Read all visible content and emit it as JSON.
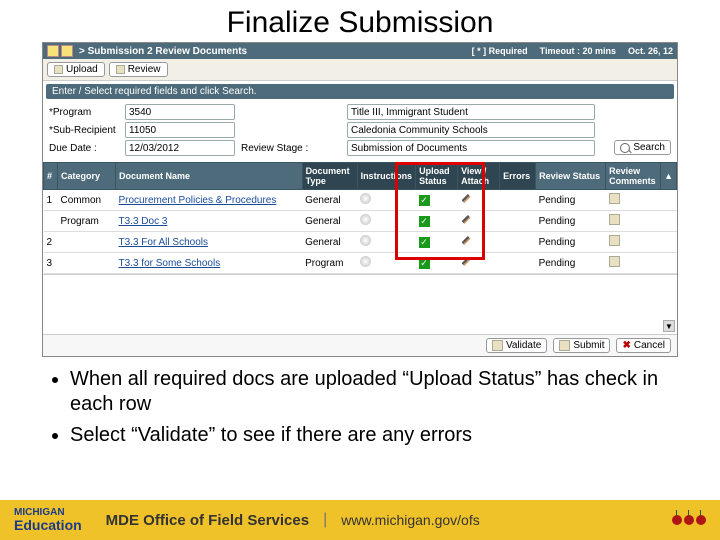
{
  "slide_title": "Finalize Submission",
  "crumb": {
    "path": "> Submission 2 Review Documents",
    "required": "[ * ]   Required",
    "timeout": "Timeout : 20 mins",
    "date": "Oct. 26, 12"
  },
  "tabs": {
    "upload": "Upload",
    "review": "Review"
  },
  "hint": "Enter / Select required fields and click Search.",
  "form": {
    "program_lbl": "*Program",
    "program_val": "3540",
    "program_desc": "Title III, Immigrant Student",
    "subrecipient_lbl": "*Sub-Recipient",
    "subrecipient_val": "11050",
    "subrecipient_desc": "Caledonia Community Schools",
    "due_lbl": "Due Date :",
    "due_val": "12/03/2012",
    "stage_lbl": "Review Stage :",
    "stage_val": "Submission of Documents",
    "search": "Search"
  },
  "cols": {
    "num": "#",
    "cat": "Category",
    "doc": "Document Name",
    "type": "Document Type",
    "instr": "Instructions",
    "upload": "Upload Status",
    "view": "View / Attach",
    "err": "Errors",
    "rstatus": "Review Status",
    "rcomm": "Review Comments"
  },
  "rows": [
    {
      "n": "1",
      "cat": "Common",
      "doc": "Procurement Policies & Procedures",
      "type": "General",
      "rev": "Pending"
    },
    {
      "n": "",
      "cat": "Program",
      "doc": "T3.3 Doc 3",
      "type": "General",
      "rev": "Pending"
    },
    {
      "n": "2",
      "cat": "",
      "doc": "T3.3 For All Schools",
      "type": "General",
      "rev": "Pending"
    },
    {
      "n": "3",
      "cat": "",
      "doc": "T3.3 for Some Schools",
      "type": "Program",
      "rev": "Pending"
    }
  ],
  "actions": {
    "validate": "Validate",
    "submit": "Submit",
    "cancel": "Cancel"
  },
  "bullets": {
    "b1": "When all required docs are uploaded “Upload Status” has check in each row",
    "b2": "Select “Validate” to see if there are any errors"
  },
  "footer": {
    "mi": "MICHIGAN",
    "edu": "Education",
    "office": "MDE Office of Field Services",
    "url": "www.michigan.gov/ofs"
  }
}
